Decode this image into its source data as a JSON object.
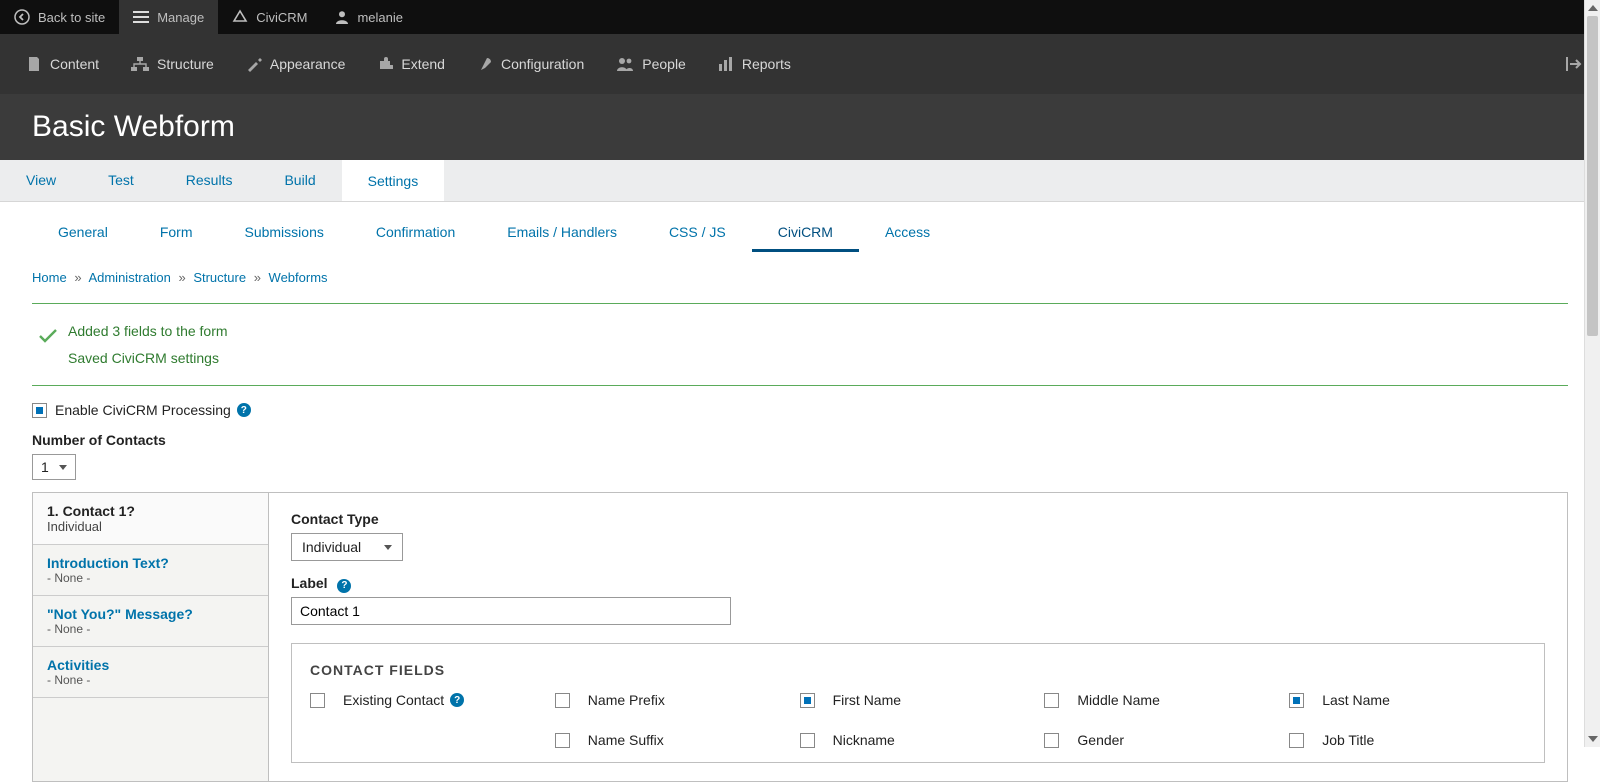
{
  "toolbar": {
    "back": "Back to site",
    "manage": "Manage",
    "civicrm": "CiviCRM",
    "user": "melanie"
  },
  "admin_menu": {
    "content": "Content",
    "structure": "Structure",
    "appearance": "Appearance",
    "extend": "Extend",
    "configuration": "Configuration",
    "people": "People",
    "reports": "Reports"
  },
  "page_title": "Basic Webform",
  "primary_tabs": {
    "view": "View",
    "test": "Test",
    "results": "Results",
    "build": "Build",
    "settings": "Settings"
  },
  "secondary_tabs": {
    "general": "General",
    "form": "Form",
    "submissions": "Submissions",
    "confirmation": "Confirmation",
    "emails": "Emails / Handlers",
    "cssjs": "CSS / JS",
    "civicrm": "CiviCRM",
    "access": "Access"
  },
  "breadcrumbs": {
    "home": "Home",
    "administration": "Administration",
    "structure": "Structure",
    "webforms": "Webforms",
    "sep": "»"
  },
  "status": {
    "line1": "Added 3 fields to the form",
    "line2": "Saved CiviCRM settings"
  },
  "enable_label": "Enable CiviCRM Processing",
  "num_contacts_label": "Number of Contacts",
  "num_contacts_value": "1",
  "side": {
    "contact_title": "1. Contact 1?",
    "contact_sub": "Individual",
    "intro_title": "Introduction Text?",
    "intro_sub": "- None -",
    "notyou_title": "\"Not You?\" Message?",
    "notyou_sub": "- None -",
    "activities_title": "Activities",
    "activities_sub": "- None -"
  },
  "main": {
    "contact_type_label": "Contact Type",
    "contact_type_value": "Individual",
    "label_label": "Label",
    "label_value": "Contact 1",
    "fieldset_legend": "CONTACT FIELDS",
    "fields": {
      "existing": "Existing Contact",
      "name_prefix": "Name Prefix",
      "first_name": "First Name",
      "middle_name": "Middle Name",
      "last_name": "Last Name",
      "name_suffix": "Name Suffix",
      "nickname": "Nickname",
      "gender": "Gender",
      "job_title": "Job Title"
    }
  }
}
